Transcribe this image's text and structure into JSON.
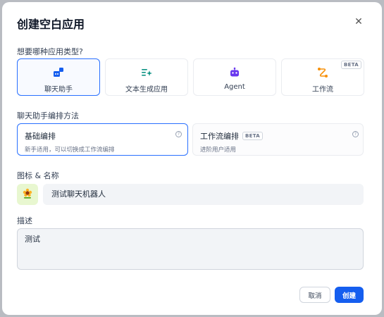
{
  "modal": {
    "title": "创建空白应用",
    "close_icon": "close-icon"
  },
  "app_type": {
    "label": "想要哪种应用类型?",
    "options": [
      {
        "label": "聊天助手",
        "icon": "chat-assistant-icon",
        "selected": true
      },
      {
        "label": "文本生成应用",
        "icon": "text-generation-icon",
        "selected": false
      },
      {
        "label": "Agent",
        "icon": "agent-robot-icon",
        "selected": false
      },
      {
        "label": "工作流",
        "icon": "workflow-icon",
        "selected": false,
        "badge": "BETA"
      }
    ]
  },
  "orchestration": {
    "label": "聊天助手编排方法",
    "options": [
      {
        "title": "基础编排",
        "desc": "新手适用，可以切换成工作流编排",
        "selected": true
      },
      {
        "title": "工作流编排",
        "desc": "进阶用户适用",
        "badge": "BETA",
        "selected": false
      }
    ]
  },
  "icon_name": {
    "label": "图标 & 名称",
    "avatar_icon": "sunflower-emoji-icon",
    "name_value": "测试聊天机器人"
  },
  "description": {
    "label": "描述",
    "value": "测试"
  },
  "actions": {
    "cancel": "取消",
    "create": "创建"
  },
  "colors": {
    "accent": "#155eef",
    "selected_border": "#2970ff",
    "avatar_bg": "#e8f7d0"
  }
}
